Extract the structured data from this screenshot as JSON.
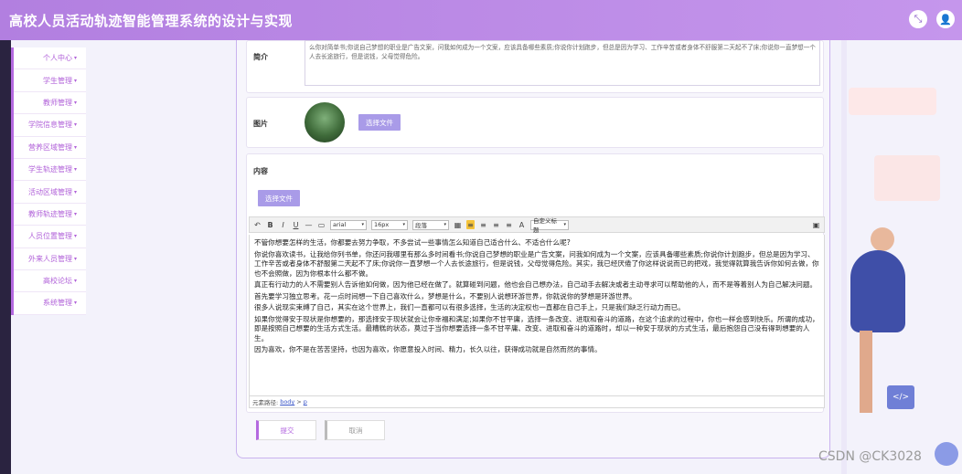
{
  "header": {
    "title": "高校人员活动轨迹智能管理系统的设计与实现",
    "exit_icon": "exit-fullscreen-icon",
    "user_icon": "user-icon"
  },
  "sidebar": {
    "items": [
      {
        "label": "个人中心"
      },
      {
        "label": "学生管理"
      },
      {
        "label": "教师管理"
      },
      {
        "label": "学院信息管理"
      },
      {
        "label": "营养区域管理"
      },
      {
        "label": "学生轨迹管理"
      },
      {
        "label": "活动区域管理"
      },
      {
        "label": "教师轨迹管理"
      },
      {
        "label": "人员位置管理"
      },
      {
        "label": "外来人员管理"
      },
      {
        "label": "高校论坛"
      },
      {
        "label": "系统管理"
      }
    ]
  },
  "form": {
    "intro_label": "简介",
    "intro_text": "么你对简单书;你说自己梦想的职业是广告文案，问我如何成为一个文案，应该具备哪些素质;你说你计划跑步，但总是因为学习、工作辛苦或者身体不舒服第二天起不了床;你说你一直梦想一个人去长途旅行，但是说钱，父母觉得危险。",
    "picture_label": "图片",
    "picture_button": "选择文件",
    "content_label": "内容",
    "content_button": "选择文件"
  },
  "editor": {
    "font_family": "arial",
    "font_size": "16px",
    "paragraph": "段落",
    "line_height": "自定义标题",
    "paragraphs": [
      "不管你想要怎样的生活，你都要去努力争取，不多尝试一些事情怎么知道自己适合什么、不适合什么呢?",
      "你说你喜欢读书，让我给你列书单，你还问我哪里有那么多时间看书;你说自己梦想的职业是广告文案，问我如何成为一个文案，应该具备哪些素质;你说你计划跑步，但总是因为学习、工作辛苦或者身体不舒服第二天起不了床;你说你一直梦想一个人去长途旅行，但是说钱，父母觉得危险。其实，我已经厌倦了你这样说说而已的把戏，我觉得就算我告诉你如何去做，你也不会照做，因为你根本什么都不做。",
      "真正有行动力的人不需要别人告诉他如何做，因为他已经在做了。就算碰到问题，他也会自己想办法，自己动手去解决或者主动寻求可以帮助他的人，而不是等着别人为自己解决问题。",
      "首先要学习独立思考。花一点时间想一下自己喜欢什么，梦想是什么，不要别人说想环游世界，你就说你的梦想是环游世界。",
      "很多人说现实束缚了自己，其实在这个世界上，我们一直都可以有很多选择，生活的决定权也一直都在自己手上，只是我们缺乏行动力而已。",
      "如果你觉得安于现状是你想要的，那选择安于现状就会让你幸福和满足;如果你不甘平庸，选择一条改变、进取和奋斗的道路，在这个追求的过程中，你也一样会感到快乐。所谓的成功，即是按照自己想要的生活方式生活。最糟糕的状态，莫过于当你想要选择一条不甘平庸、改变、进取和奋斗的道路时，却以一种安于现状的方式生活，最后抱怨自己没有得到想要的人生。",
      "因为喜欢，你不是在苦苦坚持，也因为喜欢，你愿意投入时间、精力，长久以往，获得成功就是自然而然的事情。"
    ],
    "path_prefix": "元素路径:",
    "path_body": "body",
    "path_sep": ">",
    "path_p": "p"
  },
  "actions": {
    "submit": "提交",
    "cancel": "取消"
  },
  "watermark": "CSDN @CK3028",
  "colors": {
    "header": "#b27fe0",
    "accent": "#b469e0",
    "button": "#a99be8"
  }
}
